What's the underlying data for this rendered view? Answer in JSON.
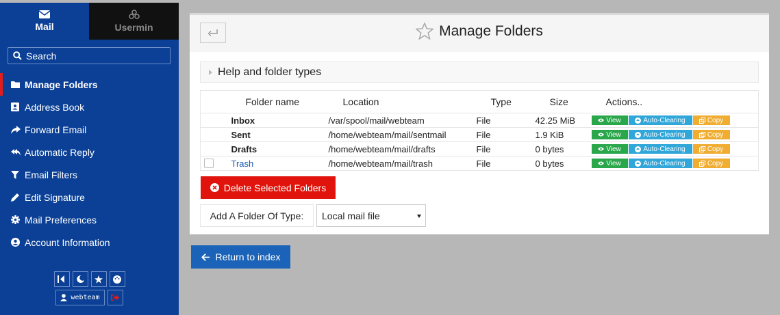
{
  "sidebar": {
    "tabs": [
      {
        "label": "Mail",
        "icon": "envelope-icon",
        "active": true
      },
      {
        "label": "Usermin",
        "icon": "usermin-logo-icon",
        "active": false
      }
    ],
    "search": {
      "label": "Search"
    },
    "items": [
      {
        "label": "Manage Folders",
        "icon": "folder-icon",
        "active": true
      },
      {
        "label": "Address Book",
        "icon": "address-book-icon"
      },
      {
        "label": "Forward Email",
        "icon": "share-icon"
      },
      {
        "label": "Automatic Reply",
        "icon": "reply-all-icon"
      },
      {
        "label": "Email Filters",
        "icon": "filter-icon"
      },
      {
        "label": "Edit Signature",
        "icon": "pencil-icon"
      },
      {
        "label": "Mail Preferences",
        "icon": "gear-icon"
      },
      {
        "label": "Account Information",
        "icon": "user-circle-icon"
      }
    ],
    "footer": {
      "username": "webteam"
    }
  },
  "page": {
    "title": "Manage Folders",
    "help_label": "Help and folder types"
  },
  "table": {
    "headers": [
      "Folder name",
      "Location",
      "Type",
      "Size",
      "Actions.."
    ],
    "rows": [
      {
        "name": "Inbox",
        "location": "/var/spool/mail/webteam",
        "type": "File",
        "size": "42.25 MiB",
        "deletable": false
      },
      {
        "name": "Sent",
        "location": "/home/webteam/mail/sentmail",
        "type": "File",
        "size": "1.9 KiB",
        "deletable": false
      },
      {
        "name": "Drafts",
        "location": "/home/webteam/mail/drafts",
        "type": "File",
        "size": "0 bytes",
        "deletable": false
      },
      {
        "name": "Trash",
        "location": "/home/webteam/mail/trash",
        "type": "File",
        "size": "0 bytes",
        "deletable": true
      }
    ],
    "actions": {
      "view": "View",
      "auto_clearing": "Auto-Clearing",
      "copy": "Copy"
    }
  },
  "controls": {
    "delete_label": "Delete Selected Folders",
    "add_label": "Add A Folder Of Type:",
    "add_select_value": "Local mail file",
    "return_label": "Return to index"
  },
  "colors": {
    "sidebar_bg": "#0b4096",
    "danger": "#e0140c",
    "view": "#2aa64b",
    "auto_clearing": "#30a6d9",
    "copy": "#f0ad32",
    "primary": "#1b63b8"
  }
}
